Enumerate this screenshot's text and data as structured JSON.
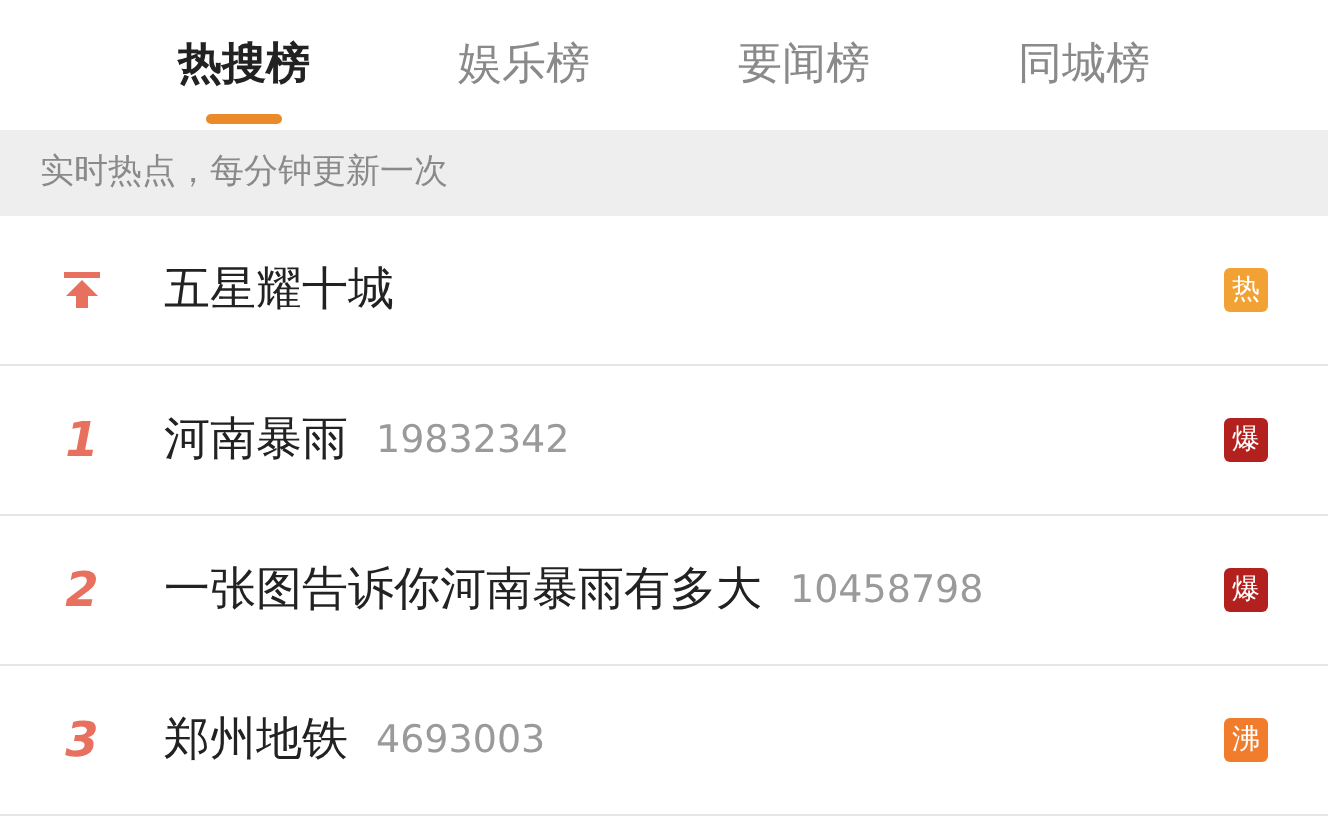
{
  "tabs": [
    {
      "label": "热搜榜",
      "selected": true
    },
    {
      "label": "娱乐榜",
      "selected": false
    },
    {
      "label": "要闻榜",
      "selected": false
    },
    {
      "label": "同城榜",
      "selected": false
    }
  ],
  "notice": "实时热点，每分钟更新一次",
  "items": [
    {
      "kind": "pinned",
      "title": "五星耀十城",
      "tag": "热",
      "color": "#f2a234"
    },
    {
      "kind": "ranked",
      "rank": "1",
      "title": "河南暴雨",
      "count": "19832342",
      "tag": "爆",
      "color": "#b3211e"
    },
    {
      "kind": "ranked",
      "rank": "2",
      "title": "一张图告诉你河南暴雨有多大",
      "count": "10458798",
      "tag": "爆",
      "color": "#b3211e"
    },
    {
      "kind": "ranked",
      "rank": "3",
      "title": "郑州地铁",
      "count": "4693003",
      "tag": "沸",
      "color": "#f07c2c"
    }
  ]
}
